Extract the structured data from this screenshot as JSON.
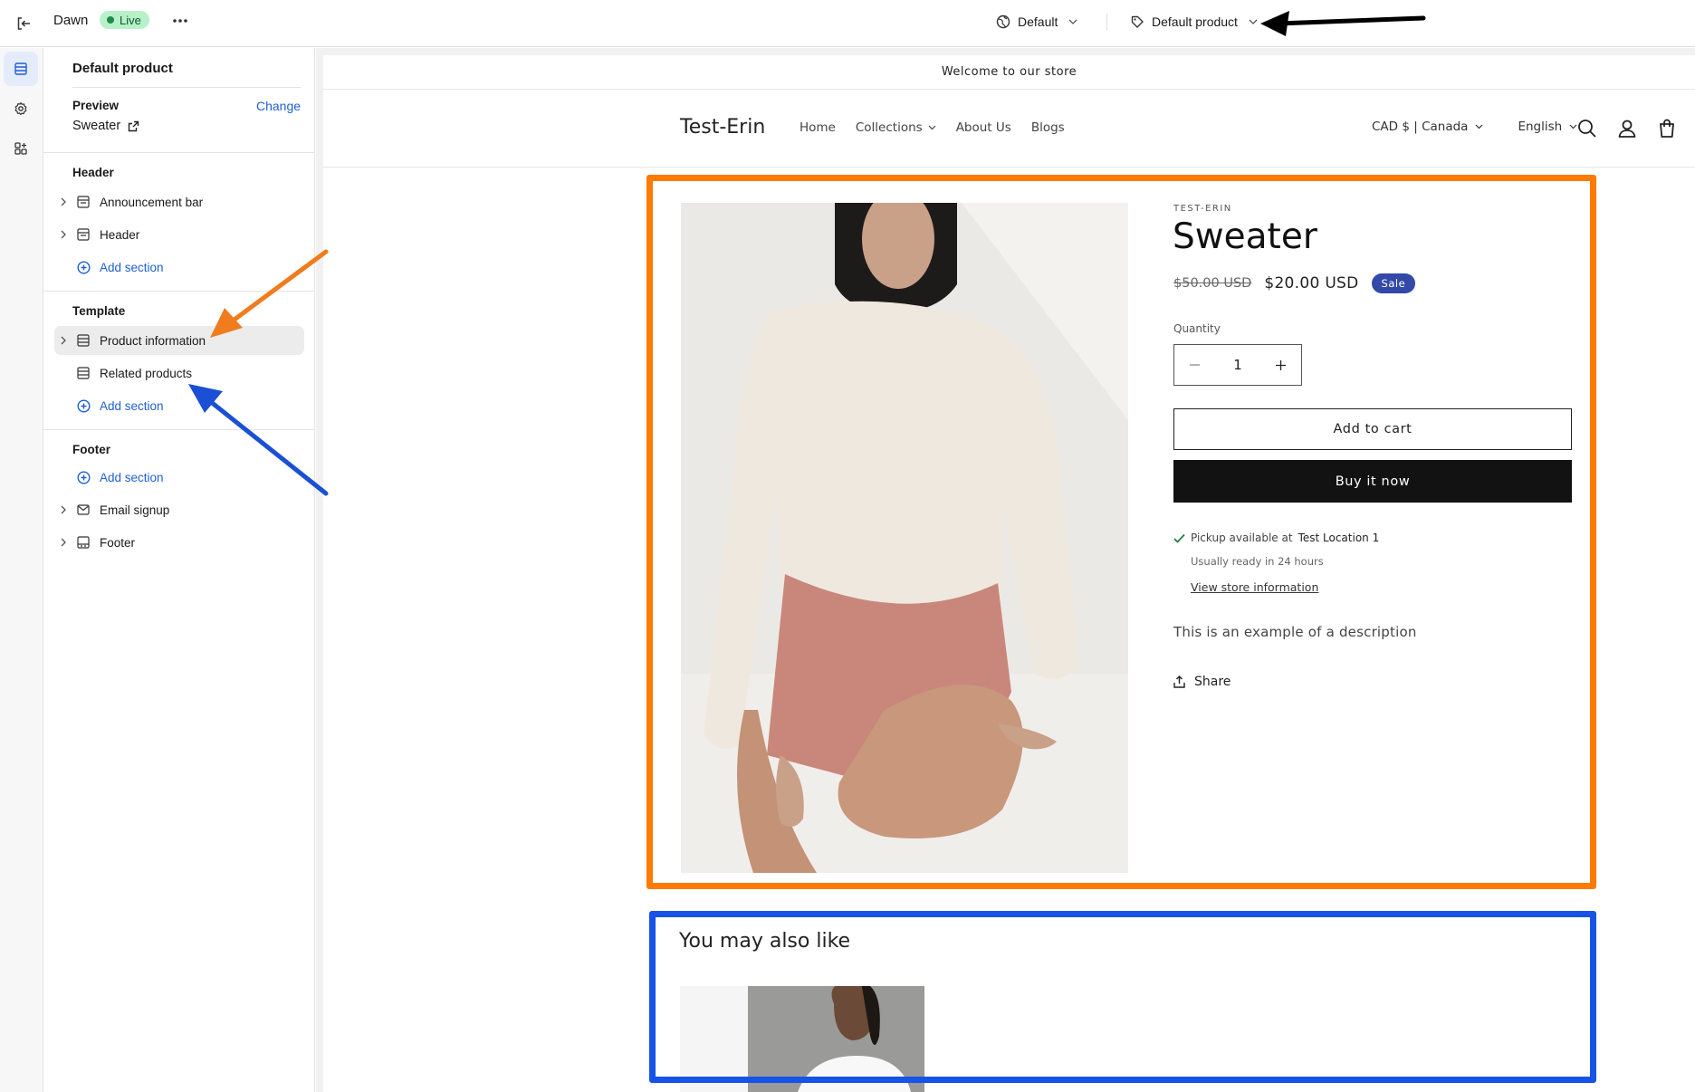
{
  "topbar": {
    "theme_name": "Dawn",
    "live_label": "Live",
    "default_selector": "Default",
    "template_selector": "Default product"
  },
  "panel": {
    "title": "Default product",
    "preview_label": "Preview",
    "preview_change": "Change",
    "preview_value": "Sweater",
    "groups": {
      "header": {
        "label": "Header",
        "items": [
          "Announcement bar",
          "Header"
        ],
        "add": "Add section"
      },
      "template": {
        "label": "Template",
        "items": [
          "Product information",
          "Related products"
        ],
        "add": "Add section"
      },
      "footer": {
        "label": "Footer",
        "add": "Add section",
        "items": [
          "Email signup",
          "Footer"
        ]
      }
    }
  },
  "store": {
    "announcement": "Welcome to our store",
    "logo": "Test-Erin",
    "nav": [
      "Home",
      "Collections",
      "About Us",
      "Blogs"
    ],
    "locale": "CAD $ | Canada",
    "language": "English"
  },
  "product": {
    "vendor": "TEST-ERIN",
    "title": "Sweater",
    "old_price": "$50.00 USD",
    "price": "$20.00 USD",
    "badge": "Sale",
    "quantity_label": "Quantity",
    "quantity": "1",
    "add_to_cart": "Add to cart",
    "buy_now": "Buy it now",
    "pickup_prefix": "Pickup available at",
    "pickup_location": "Test Location 1",
    "pickup_ready": "Usually ready in 24 hours",
    "store_info": "View store information",
    "description": "This is an example of a description",
    "share": "Share"
  },
  "related": {
    "title": "You may also like"
  },
  "colors": {
    "accent_blue": "#1f5fd1",
    "highlight_orange": "#ff7a00",
    "highlight_blue": "#1653e6",
    "sale_badge": "#3349a8",
    "live_badge": "#b7f0c9"
  },
  "icons": [
    "exit-icon",
    "more-icon",
    "globe-icon",
    "tag-icon",
    "sections-icon",
    "settings-icon",
    "apps-icon",
    "external-link-icon",
    "search-icon",
    "account-icon",
    "cart-icon",
    "check-icon",
    "share-icon"
  ]
}
